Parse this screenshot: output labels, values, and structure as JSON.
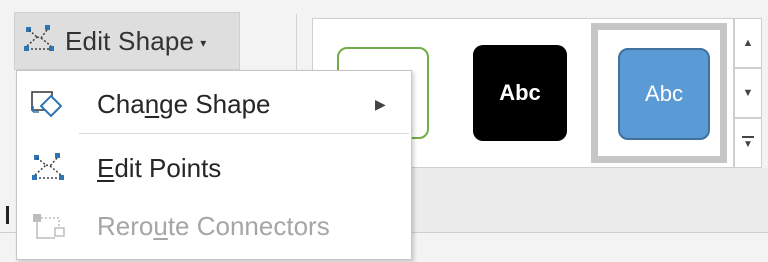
{
  "ribbon": {
    "edit_shape": {
      "label": "Edit Shape",
      "caret": "▾",
      "icon": "edit-points-icon"
    },
    "gallery": {
      "items": [
        {
          "style": "outline-green",
          "text": ""
        },
        {
          "style": "black-fill",
          "text": "Abc"
        },
        {
          "style": "blue-fill-selected",
          "text": "Abc"
        }
      ],
      "scroll_up": "▲",
      "scroll_down": "▼",
      "more": "▼"
    }
  },
  "menu": {
    "items": [
      {
        "pre": "Cha",
        "ul": "n",
        "post": "ge Shape",
        "icon": "change-shape-icon",
        "has_submenu": true,
        "submenu_arrow": "▶",
        "enabled": true
      },
      {
        "pre": "",
        "ul": "E",
        "post": "dit Points",
        "icon": "edit-points-icon",
        "has_submenu": false,
        "enabled": true
      },
      {
        "pre": "Rero",
        "ul": "u",
        "post": "te Connectors",
        "icon": "reroute-connectors-icon",
        "has_submenu": false,
        "enabled": false
      }
    ]
  },
  "colors": {
    "outline_green": "#70ad47",
    "accent_blue": "#5b9bd5",
    "selection_frame": "#c6c6c6",
    "disabled_text": "#a6a6a6"
  }
}
